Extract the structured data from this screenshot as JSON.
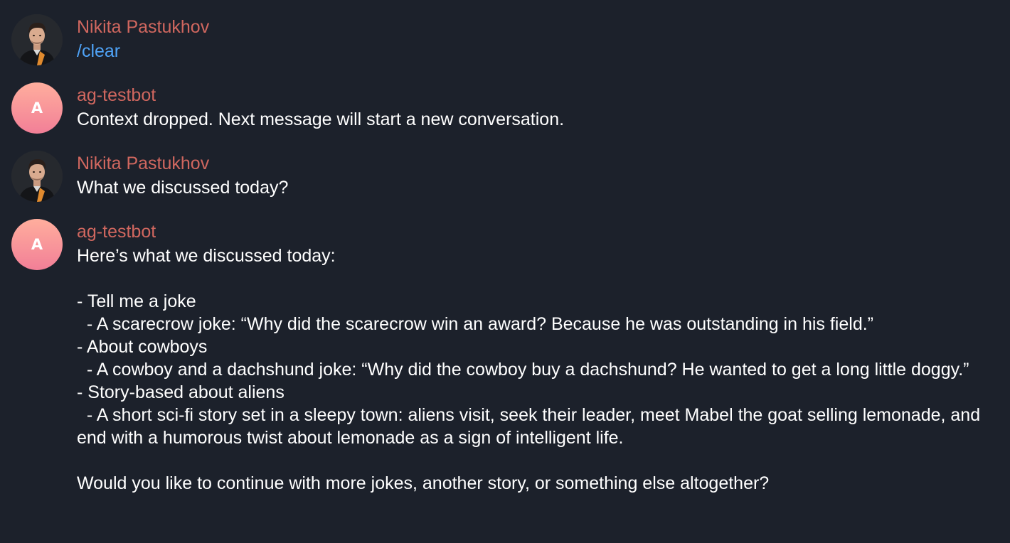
{
  "messages": [
    {
      "author": "Nikita Pastukhov",
      "avatar": {
        "type": "photo",
        "icon": "user-photo-avatar"
      },
      "text": "/clear",
      "is_command": true
    },
    {
      "author": "ag-testbot",
      "avatar": {
        "type": "letter",
        "letter": "A",
        "gradient": [
          "#ffae9d",
          "#f27f97"
        ]
      },
      "text": "Context dropped. Next message will start a new conversation."
    },
    {
      "author": "Nikita Pastukhov",
      "avatar": {
        "type": "photo",
        "icon": "user-photo-avatar"
      },
      "text": "What we discussed today?"
    },
    {
      "author": "ag-testbot",
      "avatar": {
        "type": "letter",
        "letter": "A",
        "gradient": [
          "#ffae9d",
          "#f27f97"
        ]
      },
      "text": "Here’s what we discussed today:\n\n- Tell me a joke\n  - A scarecrow joke: “Why did the scarecrow win an award? Because he was outstanding in his field.”\n- About cowboys\n  - A cowboy and a dachshund joke: “Why did the cowboy buy a dachshund? He wanted to get a long little doggy.”\n- Story-based about aliens\n  - A short sci-fi story set in a sleepy town: aliens visit, seek their leader, meet Mabel the goat selling lemonade, and end with a humorous twist about lemonade as a sign of intelligent life.\n\nWould you like to continue with more jokes, another story, or something else altogether?"
    }
  ],
  "colors": {
    "background": "#1c212b",
    "author_name": "#d0675f",
    "command_link": "#4fa3f7",
    "message_text": "#ffffff"
  }
}
